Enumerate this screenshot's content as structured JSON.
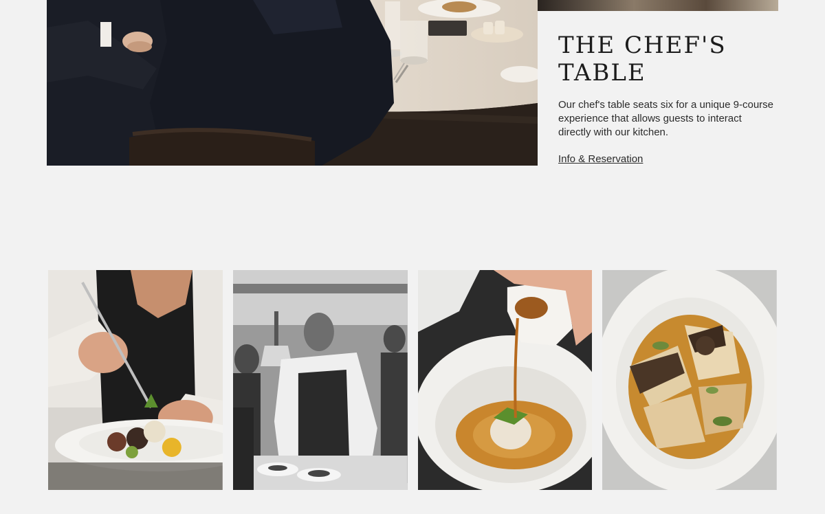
{
  "hero": {
    "image_alt": "Guests seated at a curved counter with plated dishes and glassware"
  },
  "card": {
    "title": "THE CHEF'S TABLE",
    "description": "Our chef's table seats six for a unique 9-course experience that allows guests to interact directly with our kitchen.",
    "link_label": "Info & Reservation"
  },
  "gallery": {
    "items": [
      {
        "alt": "Chef plating a dish with tweezers"
      },
      {
        "alt": "Chef working in the kitchen, black and white"
      },
      {
        "alt": "Broth being poured into a bowl"
      },
      {
        "alt": "Plated pasta dish with mushrooms"
      }
    ]
  },
  "colors": {
    "page_background": "#f2f2f2",
    "text": "#2b2b2b",
    "title": "#1c1c1c"
  }
}
